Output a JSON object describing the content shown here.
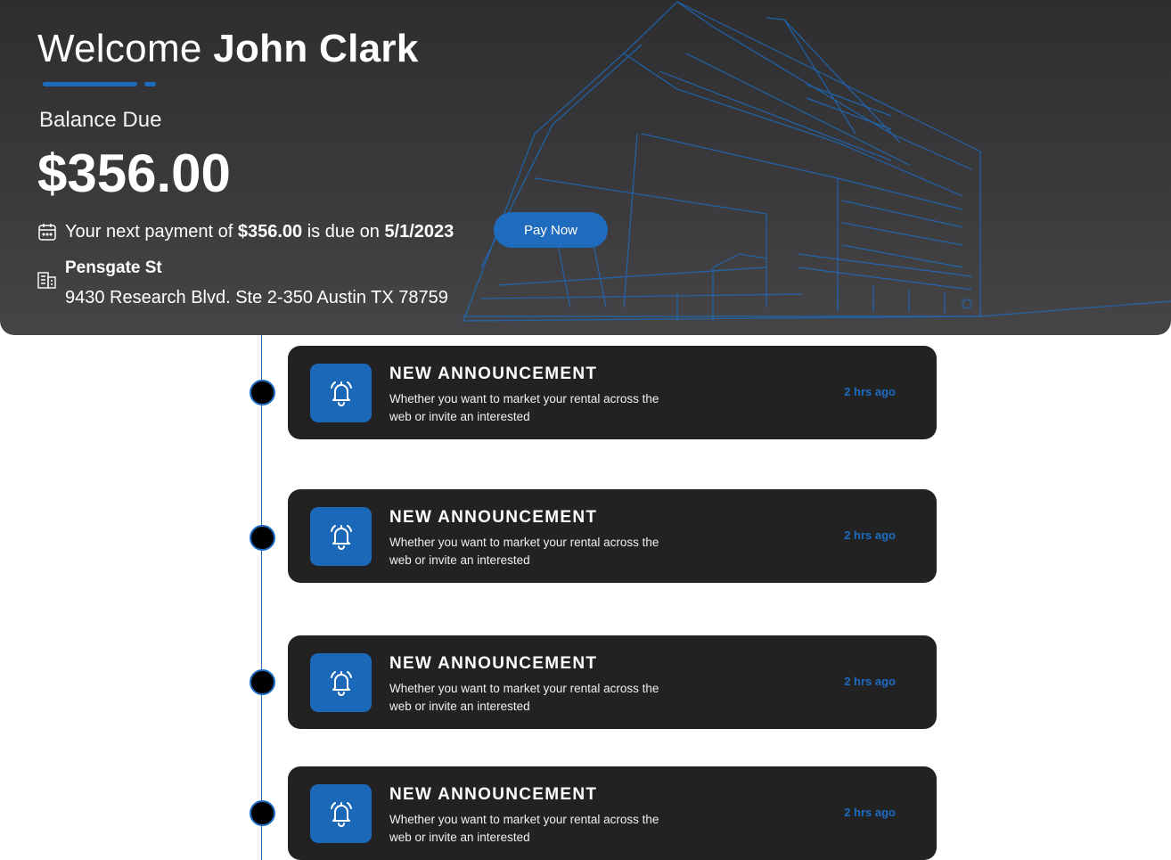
{
  "header": {
    "welcome_prefix": "Welcome",
    "user_name": "John Clark",
    "balance_label": "Balance Due",
    "balance_amount": "$356.00",
    "payment_prefix": "Your next payment of",
    "payment_amount": "$356.00",
    "payment_middle": "is due on",
    "payment_date": "5/1/2023",
    "pay_button_label": "Pay Now",
    "property_name": "Pensgate St",
    "property_address": "9430 Research Blvd. Ste 2-350 Austin TX 78759",
    "calendar_icon": "calendar-icon",
    "building_icon": "building-icon"
  },
  "colors": {
    "accent": "#1d6bc0",
    "hero_background": "#3a3a3c",
    "card_background": "#222223",
    "dot": "#000000"
  },
  "announcements": [
    {
      "title": "NEW ANNOUNCEMENT",
      "body": "Whether you want to market your rental across the web or invite an interested",
      "time": "2 hrs ago",
      "icon": "bell-icon"
    },
    {
      "title": "NEW ANNOUNCEMENT",
      "body": "Whether you want to market your rental across the web or invite an interested",
      "time": "2 hrs ago",
      "icon": "bell-icon"
    },
    {
      "title": "NEW ANNOUNCEMENT",
      "body": "Whether you want to market your rental across the web or invite an interested",
      "time": "2 hrs ago",
      "icon": "bell-icon"
    },
    {
      "title": "NEW ANNOUNCEMENT",
      "body": "Whether you want to market your rental across the web or invite an interested",
      "time": "2 hrs ago",
      "icon": "bell-icon"
    }
  ]
}
